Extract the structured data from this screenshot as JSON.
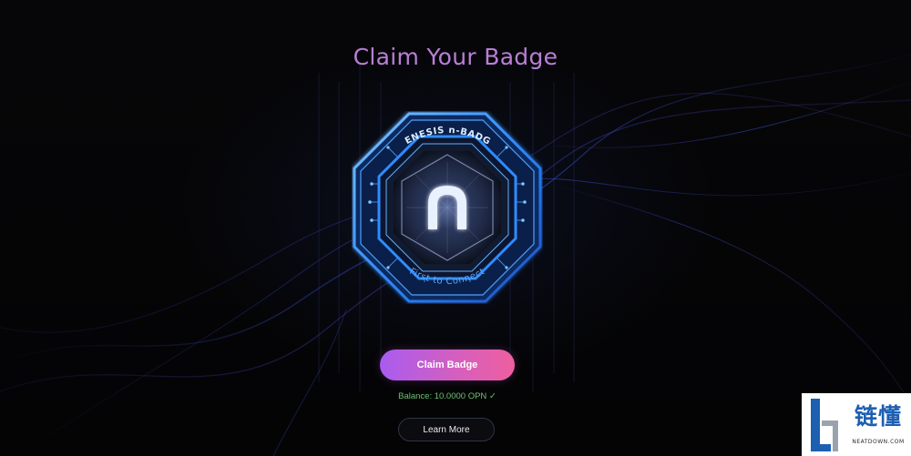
{
  "page": {
    "title": "Claim Your Badge"
  },
  "badge": {
    "header_text": "GENESIS n-BADGE",
    "footer_text": "First to Connect",
    "glyph": "n",
    "accent_color": "#2f8cff"
  },
  "actions": {
    "claim_label": "Claim Badge",
    "learn_more_label": "Learn More"
  },
  "balance": {
    "text": "Balance: 10.0000 OPN ✓"
  },
  "watermark": {
    "cn_text": "链懂",
    "en_text": "NEATDOWN.COM"
  },
  "colors": {
    "title": "#b87fd6",
    "button_gradient_start": "#a85cf0",
    "button_gradient_end": "#ef5f9e",
    "balance": "#6cc070",
    "background": "#050507"
  }
}
